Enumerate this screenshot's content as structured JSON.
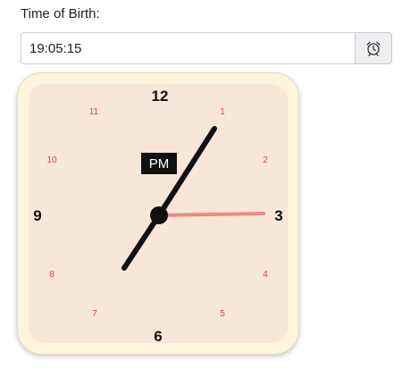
{
  "form": {
    "label": "Time of Birth:",
    "time_value": "19:05:15"
  },
  "addon": {
    "icon": "alarm-clock-icon"
  },
  "clock": {
    "numbers": {
      "n12": "12",
      "n1": "1",
      "n2": "2",
      "n3": "3",
      "n4": "4",
      "n5": "5",
      "n6": "6",
      "n7": "7",
      "n8": "8",
      "n9": "9",
      "n10": "10",
      "n11": "11"
    },
    "ampm": "PM",
    "colors": {
      "frame": "#fcf5dc",
      "face": "#f8e7d6",
      "hands": "#111111",
      "second_hand": "#ec8a84",
      "minor_numbers": "#d04a3a"
    }
  }
}
